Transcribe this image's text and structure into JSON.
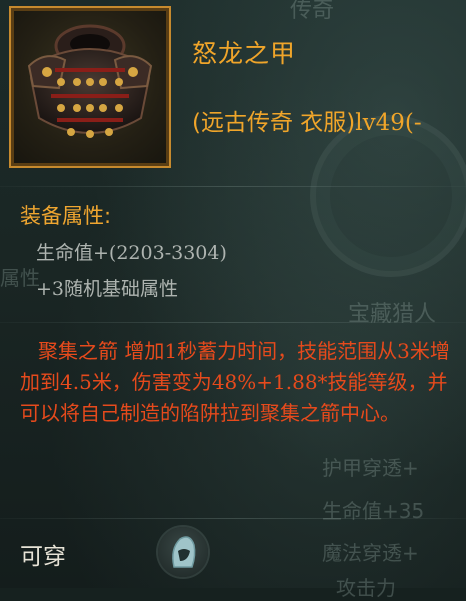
{
  "item": {
    "name": "怒龙之甲",
    "subtitle_prefix": "(远古传奇 衣服)",
    "level": "lv49(-",
    "icon": "chest-armor-icon"
  },
  "attributes": {
    "title": "装备属性:",
    "hp_label": "生命值",
    "hp_value": "+(2203-3304)",
    "random_prefix": "+3",
    "random_label": "随机基础属性"
  },
  "description": {
    "part1": "聚集之箭 增加",
    "n1": "1",
    "part2": "秒蓄力时间，技能范围从",
    "n2": "3",
    "part3": "米增加到",
    "n3": "4.5",
    "part4": "米，伤害变为",
    "n4": "48%+1.88*",
    "part5": "技能等级，并可以将自己制造的陷阱拉到聚集之箭中心。"
  },
  "footer": {
    "wearable": "可穿",
    "class_icon": "hooded-head-icon"
  },
  "background_text": {
    "top_tab": "传奇",
    "left_fragment": "属性",
    "treasure": "宝藏猎人",
    "armor_pierce": "护甲穿透+",
    "hp": "生命值+35",
    "magic_pierce": "魔法穿透+",
    "attack": "攻击力"
  },
  "colors": {
    "accent": "#f0a52a",
    "description": "#e64a1c",
    "slot_border": "#c68a2e"
  }
}
